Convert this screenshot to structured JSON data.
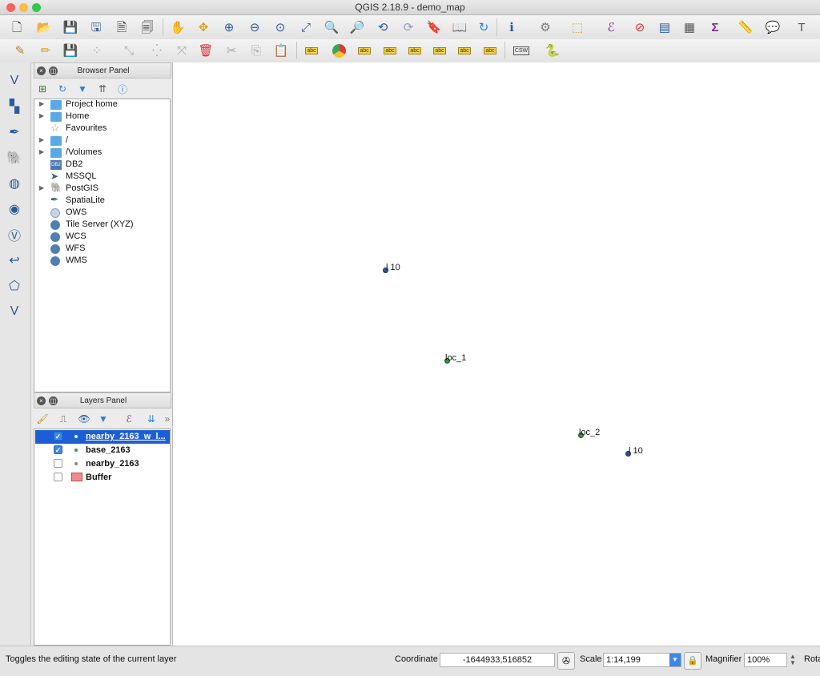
{
  "window": {
    "title": "QGIS 2.18.9 - demo_map"
  },
  "colors": {
    "selection": "#1c5ed6",
    "point_blue": "#2f5597",
    "point_green": "#2e9b3c",
    "buffer": "#f28c8c"
  },
  "toolbar1": {
    "icons": [
      "new-project-icon",
      "open-project-icon",
      "save-project-icon",
      "save-as-icon",
      "new-print-composer-icon",
      "composer-manager-icon",
      "pan-icon",
      "pan-to-selection-icon",
      "zoom-in-icon",
      "zoom-out-icon",
      "zoom-native-icon",
      "zoom-full-icon",
      "zoom-to-selection-icon",
      "zoom-to-layer-icon",
      "zoom-last-icon",
      "zoom-next-icon",
      "new-bookmark-icon",
      "show-bookmarks-icon",
      "refresh-icon",
      "identify-icon",
      "action-icon",
      "select-icon",
      "select-expression-icon",
      "deselect-icon",
      "attribute-table-icon",
      "field-calculator-icon",
      "statistics-icon",
      "measure-icon",
      "map-tips-icon",
      "text-annotation-icon"
    ]
  },
  "toolbar2": {
    "icons": [
      "current-edits-icon",
      "toggle-editing-icon",
      "save-edits-icon",
      "add-feature-icon",
      "move-feature-icon",
      "node-tool-icon",
      "delete-selected-icon",
      "cut-features-icon",
      "copy-features-icon",
      "paste-features-icon",
      "label-icon",
      "diagram-icon",
      "pin-labels-icon",
      "show-hide-labels-icon",
      "move-label-icon",
      "rotate-label-icon",
      "change-label-icon",
      "csw-icon",
      "python-icon"
    ],
    "csw_label": "CSW",
    "abc_label": "abc"
  },
  "left_toolbar": {
    "icons": [
      "add-vector-layer-icon",
      "add-raster-layer-icon",
      "add-spatialite-layer-icon",
      "add-postgis-layer-icon",
      "add-wms-layer-icon",
      "add-wcs-layer-icon",
      "add-wfs-layer-icon",
      "add-delimited-text-icon",
      "add-virtual-layer-icon",
      "new-layer-icon"
    ]
  },
  "browser_panel": {
    "title": "Browser Panel",
    "items": [
      {
        "label": "Project home",
        "icon": "folder-icon",
        "expandable": true
      },
      {
        "label": "Home",
        "icon": "folder-icon",
        "expandable": true
      },
      {
        "label": "Favourites",
        "icon": "star-icon",
        "expandable": false
      },
      {
        "label": "/",
        "icon": "folder-icon",
        "expandable": true
      },
      {
        "label": "/Volumes",
        "icon": "folder-icon",
        "expandable": true
      },
      {
        "label": "DB2",
        "icon": "db2-icon",
        "expandable": false
      },
      {
        "label": "MSSQL",
        "icon": "mssql-icon",
        "expandable": false
      },
      {
        "label": "PostGIS",
        "icon": "postgis-icon",
        "expandable": true
      },
      {
        "label": "SpatiaLite",
        "icon": "spatialite-icon",
        "expandable": false
      },
      {
        "label": "OWS",
        "icon": "ows-icon",
        "expandable": false
      },
      {
        "label": "Tile Server (XYZ)",
        "icon": "tile-server-icon",
        "expandable": false
      },
      {
        "label": "WCS",
        "icon": "wcs-icon",
        "expandable": false
      },
      {
        "label": "WFS",
        "icon": "wfs-icon",
        "expandable": false
      },
      {
        "label": "WMS",
        "icon": "wms-icon",
        "expandable": false
      }
    ],
    "db2_badge": "DB2"
  },
  "layers_panel": {
    "title": "Layers Panel",
    "layers": [
      {
        "label": "nearby_2163_w_l...",
        "checked": true,
        "selected": true,
        "symbol": "point-blue"
      },
      {
        "label": "base_2163",
        "checked": true,
        "selected": false,
        "symbol": "point-green"
      },
      {
        "label": "nearby_2163",
        "checked": false,
        "selected": false,
        "symbol": "point-gray"
      },
      {
        "label": "Buffer",
        "checked": false,
        "selected": false,
        "symbol": "polygon-red"
      }
    ]
  },
  "map": {
    "labels": [
      "l 10",
      "loc_1",
      "loc_2",
      "l 10"
    ]
  },
  "statusbar": {
    "message": "Toggles the editing state of the current layer",
    "coordinate_label": "Coordinate",
    "coordinate_value": "-1644933,516852",
    "scale_label": "Scale",
    "scale_value": "1:14,199",
    "magnifier_label": "Magnifier",
    "magnifier_value": "100%",
    "rotation_label": "Rota"
  }
}
